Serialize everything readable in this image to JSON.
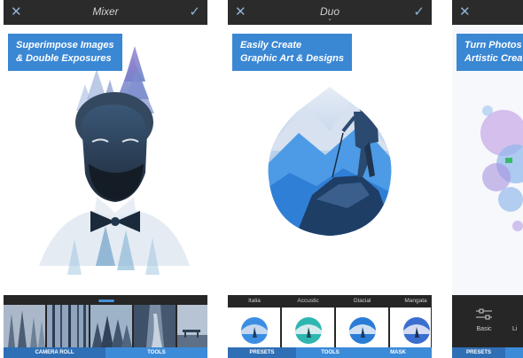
{
  "screens": [
    {
      "title": "Mixer",
      "caption": [
        "Superimpose Images",
        "& Double Exposures"
      ],
      "tabs": [
        "CAMERA ROLL",
        "TOOLS"
      ],
      "active_tab": 0,
      "thumbnails": [
        "misty-forest-1",
        "bare-trees",
        "misty-forest-2",
        "forest-road",
        "bench-fog"
      ]
    },
    {
      "title": "Duo",
      "caption": [
        "Easily Create",
        "Graphic Art & Designs"
      ],
      "presets": [
        "Italia",
        "Accustic",
        "Glacial",
        "Mangata"
      ],
      "tabs": [
        "PRESETS",
        "TOOLS",
        "MASK"
      ],
      "active_tab": 0
    },
    {
      "caption": [
        "Turn Photos into",
        "Artistic Creation"
      ],
      "tools": [
        "Basic",
        "Li"
      ],
      "tabs": [
        "PRESETS"
      ],
      "active_tab": 0
    }
  ],
  "icons": {
    "close": "close-icon",
    "confirm": "checkmark-icon",
    "dropdown": "chevron-down-icon",
    "sliders": "sliders-icon"
  },
  "colors": {
    "accent": "#3a87d4",
    "topbar": "#2b2b2b",
    "bottom_panel": "#262626",
    "tab_active": "#2f6fb5"
  }
}
